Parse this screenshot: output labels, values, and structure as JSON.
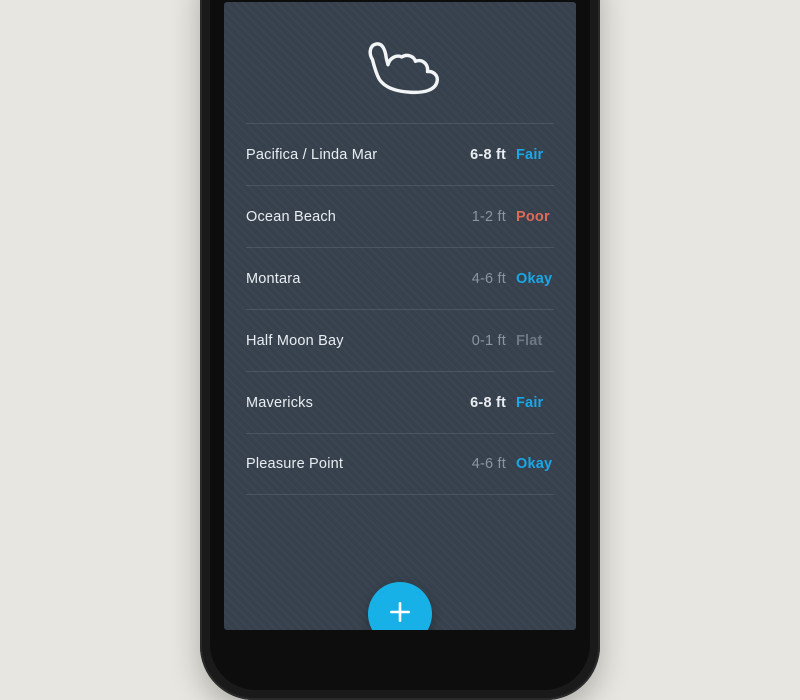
{
  "logo": "shaka-icon",
  "spots": [
    {
      "name": "Pacifica / Linda Mar",
      "height": "6-8 ft",
      "condition": "Fair",
      "cond_class": "cond-fair",
      "height_dim": false
    },
    {
      "name": "Ocean Beach",
      "height": "1-2 ft",
      "condition": "Poor",
      "cond_class": "cond-poor",
      "height_dim": true
    },
    {
      "name": "Montara",
      "height": "4-6 ft",
      "condition": "Okay",
      "cond_class": "cond-okay",
      "height_dim": true
    },
    {
      "name": "Half Moon Bay",
      "height": "0-1 ft",
      "condition": "Flat",
      "cond_class": "cond-flat",
      "height_dim": true
    },
    {
      "name": "Mavericks",
      "height": "6-8 ft",
      "condition": "Fair",
      "cond_class": "cond-fair",
      "height_dim": false
    },
    {
      "name": "Pleasure Point",
      "height": "4-6 ft",
      "condition": "Okay",
      "cond_class": "cond-okay",
      "height_dim": true
    }
  ],
  "fab": {
    "label": "+"
  }
}
